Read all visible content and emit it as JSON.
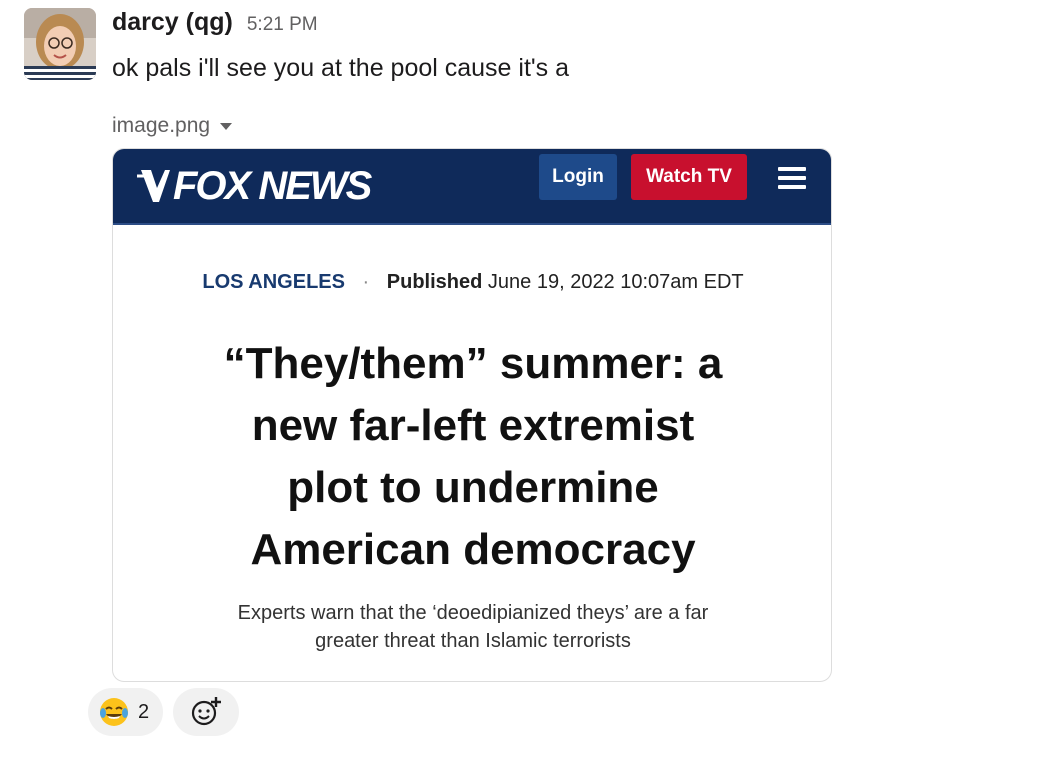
{
  "message": {
    "author": "darcy (qg)",
    "timestamp": "5:21 PM",
    "text": "ok pals i'll see you at the pool cause it's a",
    "avatar": "profile-photo"
  },
  "file": {
    "name": "image.png",
    "menu_icon": "caret-down-icon"
  },
  "attachment": {
    "brand": "FOX NEWS",
    "login_label": "Login",
    "watch_label": "Watch TV",
    "menu_icon": "hamburger-icon",
    "city": "LOS ANGELES",
    "separator": "·",
    "published_label": "Published",
    "published_date": "June 19, 2022 10:07am EDT",
    "headline_lines": [
      "“They/them” summer: a",
      "new far-left extremist",
      "plot to undermine",
      "American democracy"
    ],
    "subhead_lines": [
      "Experts warn that the ‘deoedipianized theys’ are a far",
      "greater threat than Islamic terrorists"
    ],
    "colors": {
      "navbar": "#0f2a5a",
      "login_button": "#1e4a8a",
      "watch_button": "#c8102e"
    }
  },
  "reactions": [
    {
      "emoji": "joy-emoji-icon",
      "count": "2"
    }
  ],
  "add_reaction_icon": "add-emoji-icon"
}
